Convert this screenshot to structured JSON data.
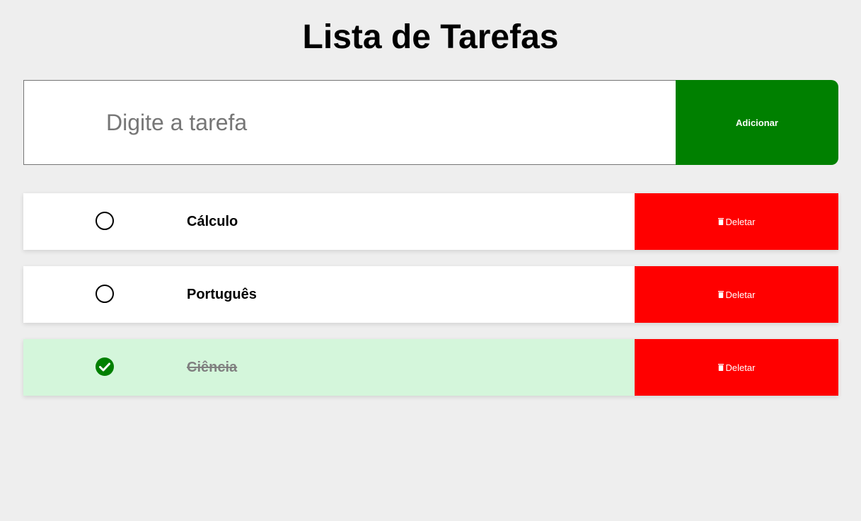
{
  "header": {
    "title": "Lista de Tarefas"
  },
  "form": {
    "input_value": "",
    "input_placeholder": "Digite a tarefa",
    "add_label": "Adicionar"
  },
  "tasks": [
    {
      "text": "Cálculo",
      "completed": false,
      "delete_label": "Deletar"
    },
    {
      "text": "Português",
      "completed": false,
      "delete_label": "Deletar"
    },
    {
      "text": "Ciência",
      "completed": true,
      "delete_label": "Deletar"
    }
  ],
  "icons": {
    "toggle_unchecked": "circle-icon",
    "toggle_checked": "check-circle-icon",
    "delete": "trash-icon"
  },
  "colors": {
    "background": "#eeeeee",
    "add_button": "#008000",
    "delete_button": "#ff0000",
    "completed_row": "#d4f6db",
    "check": "#008000"
  }
}
